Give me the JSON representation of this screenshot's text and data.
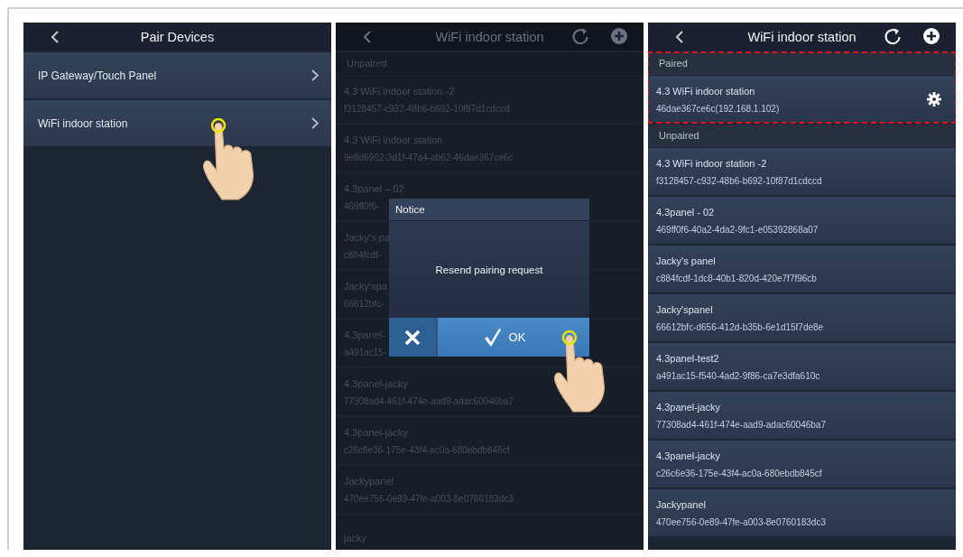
{
  "screens": [
    {
      "kind": "menu",
      "title": "Pair Devices",
      "items": [
        {
          "label": "IP Gateway/Touch Panel",
          "tapped": false
        },
        {
          "label": "WiFi indoor station",
          "tapped": true
        }
      ]
    },
    {
      "kind": "device_list",
      "title": "WiFi indoor station",
      "sections": [
        {
          "label": "Unpaired",
          "highlighted": false,
          "devices": [
            {
              "name": "4.3 WiFi indoor station -2",
              "id": "f3128457-c932-48b6-b692-10f87d1cdccd",
              "settings": false
            },
            {
              "name": "4.3 WiFi indoor station",
              "id": "9e8d6902-3d1f-47a4-ab62-46dae367ce6c",
              "settings": false
            },
            {
              "name": "4.3panel – 02",
              "id": "469ff0f6-",
              "settings": false
            },
            {
              "name": "Jacky's pa",
              "id": "c884fcdf-",
              "settings": false
            },
            {
              "name": "Jacky'spa",
              "id": "66612bfc-",
              "settings": false
            },
            {
              "name": "4.3panel-",
              "id": "a491ac15-",
              "settings": false
            },
            {
              "name": "4.3panel-jacky",
              "id": "77308ad4-461f-474e-aad9-adac60046ba7",
              "settings": false
            },
            {
              "name": "4.3panel-jacky",
              "id": "c26c6e36-175e-43f4-ac0a-680ebdb845cf",
              "settings": false
            },
            {
              "name": "Jackypanel",
              "id": "470ee756-0e89-47fe-a003-8e0760183dc3",
              "settings": false
            },
            {
              "name": "jacky",
              "settings": false
            }
          ]
        }
      ],
      "dialog": {
        "title": "Notice",
        "message": "Resend pairing request",
        "ok": "OK",
        "ok_tapped": true
      }
    },
    {
      "kind": "device_list",
      "title": "WiFi indoor station",
      "sections": [
        {
          "label": "Paired",
          "highlighted": true,
          "devices": [
            {
              "name": "4.3 WiFi indoor station",
              "id": "46dae367ce6c(192.168.1.102)",
              "settings": true
            }
          ]
        },
        {
          "label": "Unpaired",
          "highlighted": false,
          "devices": [
            {
              "name": "4.3 WiFi indoor station -2",
              "id": "f3128457-c932-48b6-b692-10f87d1cdccd",
              "settings": false
            },
            {
              "name": "4.3panel - 02",
              "id": "469ff0f6-40a2-4da2-9fc1-e05392868a07",
              "settings": false
            },
            {
              "name": "Jacky's panel",
              "id": "c884fcdf-1dc8-40b1-820d-420e7f7f96cb",
              "settings": false
            },
            {
              "name": "Jacky'spanel",
              "id": "66612bfc-d656-412d-b35b-6e1d15f7de8e",
              "settings": false
            },
            {
              "name": "4.3panel-test2",
              "id": "a491ac15-f540-4ad2-9f86-ca7e3dfa610c",
              "settings": false
            },
            {
              "name": "4.3panel-jacky",
              "id": "77308ad4-461f-474e-aad9-adac60046ba7",
              "settings": false
            },
            {
              "name": "4.3panel-jacky",
              "id": "c26c6e36-175e-43f4-ac0a-680ebdb845cf",
              "settings": false
            },
            {
              "name": "Jackypanel",
              "id": "470ee756-0e89-47fe-a003-8e0760183dc3",
              "settings": false
            }
          ]
        }
      ]
    }
  ]
}
